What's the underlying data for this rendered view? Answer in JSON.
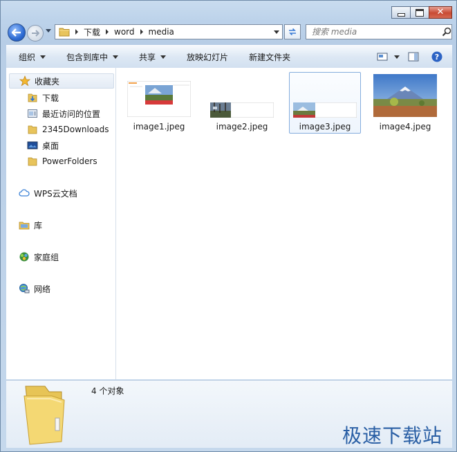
{
  "window": {
    "minimize_icon": "minimize-icon",
    "maximize_icon": "maximize-icon",
    "close_glyph": "✕"
  },
  "address": {
    "segments": [
      "下载",
      "word",
      "media"
    ]
  },
  "search": {
    "placeholder": "搜索 media"
  },
  "toolbar": {
    "organize": "组织",
    "include_in_library": "包含到库中",
    "share": "共享",
    "slideshow": "放映幻灯片",
    "new_folder": "新建文件夹"
  },
  "nav": {
    "favorites": "收藏夹",
    "downloads": "下载",
    "recent_places": "最近访问的位置",
    "downloads2345": "2345Downloads",
    "desktop": "桌面",
    "powerfolders": "PowerFolders",
    "wps_cloud": "WPS云文档",
    "library": "库",
    "homegroup": "家庭组",
    "network": "网络"
  },
  "files": [
    {
      "name": "image1.jpeg"
    },
    {
      "name": "image2.jpeg"
    },
    {
      "name": "image3.jpeg",
      "selected": true
    },
    {
      "name": "image4.jpeg"
    }
  ],
  "details": {
    "count": "4 个对象"
  },
  "watermark": "极速下载站",
  "colors": {
    "accent": "#2a5fa5",
    "close_red": "#c84a33",
    "selection": "#84acdd"
  }
}
